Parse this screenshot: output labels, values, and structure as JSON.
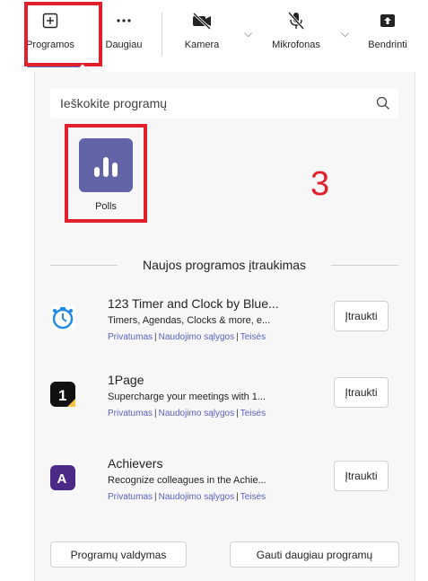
{
  "toolbar": {
    "apps_label": "Programos",
    "more_label": "Daugiau",
    "camera_label": "Kamera",
    "mic_label": "Mikrofonas",
    "share_label": "Bendrinti"
  },
  "search": {
    "placeholder": "Ieškokite programų"
  },
  "pinned_app": {
    "name": "Polls"
  },
  "annotation": {
    "step": "3"
  },
  "section_title": "Naujos programos įtraukimas",
  "apps": [
    {
      "name": "123 Timer and Clock by Blue...",
      "description": "Timers, Agendas, Clocks & more, e...",
      "privacy": "Privatumas",
      "terms": "Naudojimo sąlygos",
      "rights": "Teisės",
      "add": "Įtraukti",
      "icon": "timer-icon",
      "icon_color": "#1e88e5"
    },
    {
      "name": "1Page",
      "description": "Supercharge your meetings with 1...",
      "privacy": "Privatumas",
      "terms": "Naudojimo sąlygos",
      "rights": "Teisės",
      "add": "Įtraukti",
      "icon": "onepage-icon",
      "icon_color": "#111111"
    },
    {
      "name": "Achievers",
      "description": "Recognize colleagues in the Achie...",
      "privacy": "Privatumas",
      "terms": "Naudojimo sąlygos",
      "rights": "Teisės",
      "add": "Įtraukti",
      "icon": "achievers-icon",
      "icon_color": "#4a2a86"
    }
  ],
  "footer": {
    "manage": "Programų valdymas",
    "get_more": "Gauti daugiau programų"
  },
  "colors": {
    "accent": "#5b5fc7",
    "annotation": "#e0202a",
    "polls": "#6264a7"
  }
}
